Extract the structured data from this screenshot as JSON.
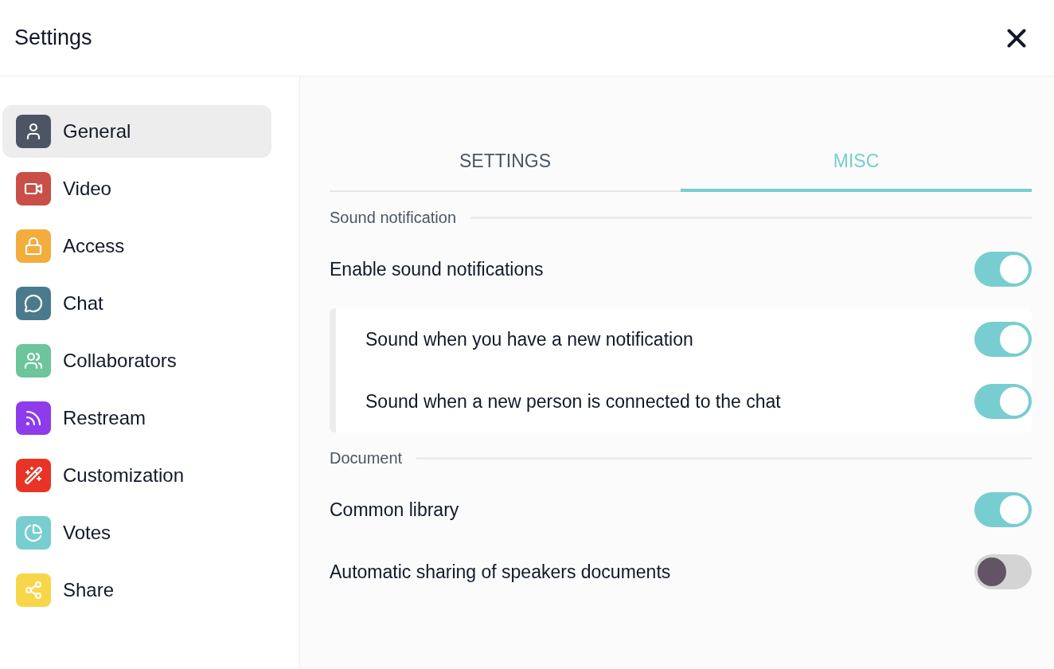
{
  "window": {
    "title": "Settings"
  },
  "sidebar": {
    "items": [
      {
        "label": "General",
        "selected": true,
        "color": "#4b5563"
      },
      {
        "label": "Video",
        "selected": false,
        "color": "#c94f48"
      },
      {
        "label": "Access",
        "selected": false,
        "color": "#f2ad3d"
      },
      {
        "label": "Chat",
        "selected": false,
        "color": "#4a7b8c"
      },
      {
        "label": "Collaborators",
        "selected": false,
        "color": "#6cc59b"
      },
      {
        "label": "Restream",
        "selected": false,
        "color": "#8e3ceb"
      },
      {
        "label": "Customization",
        "selected": false,
        "color": "#e93326"
      },
      {
        "label": "Votes",
        "selected": false,
        "color": "#78cdd0"
      },
      {
        "label": "Share",
        "selected": false,
        "color": "#f8d64a"
      }
    ]
  },
  "tabs": [
    {
      "label": "SETTINGS",
      "selected": false
    },
    {
      "label": "MISC",
      "selected": true
    }
  ],
  "sections": [
    {
      "title": "Sound notification",
      "settings": [
        {
          "label": "Enable sound notifications",
          "on": true,
          "children": [
            {
              "label": "Sound when you have a new notification",
              "on": true
            },
            {
              "label": "Sound when a new person is connected to the chat",
              "on": true
            }
          ]
        }
      ]
    },
    {
      "title": "Document",
      "settings": [
        {
          "label": "Common library",
          "on": true
        },
        {
          "label": "Automatic sharing of speakers documents",
          "on": false
        }
      ]
    }
  ]
}
